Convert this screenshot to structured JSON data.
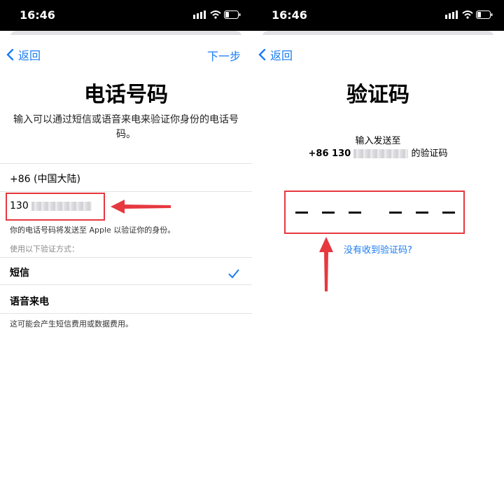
{
  "colors": {
    "accent": "#1a7cf5",
    "annotation_red": "#e6383f"
  },
  "left": {
    "status": {
      "time": "16:46"
    },
    "nav": {
      "back_label": "返回",
      "next_label": "下一步"
    },
    "title": "电话号码",
    "description": "输入可以通过短信或语音来电来验证你身份的电话号码。",
    "country": "+86 (中国大陆)",
    "phone_prefix": "130",
    "phone_note": "你的电话号码将发送至 Apple 以验证你的身份。",
    "method_header": "使用以下验证方式：",
    "methods": [
      {
        "label": "短信",
        "selected": true
      },
      {
        "label": "语音来电",
        "selected": false
      }
    ],
    "fee_note": "这可能会产生短信费用或数据费用。"
  },
  "right": {
    "status": {
      "time": "16:46"
    },
    "nav": {
      "back_label": "返回"
    },
    "title": "验证码",
    "sent_to": "输入发送至",
    "sent_number_prefix": "+86 130",
    "sent_suffix": "的验证码",
    "resend_link": "没有收到验证码?"
  }
}
